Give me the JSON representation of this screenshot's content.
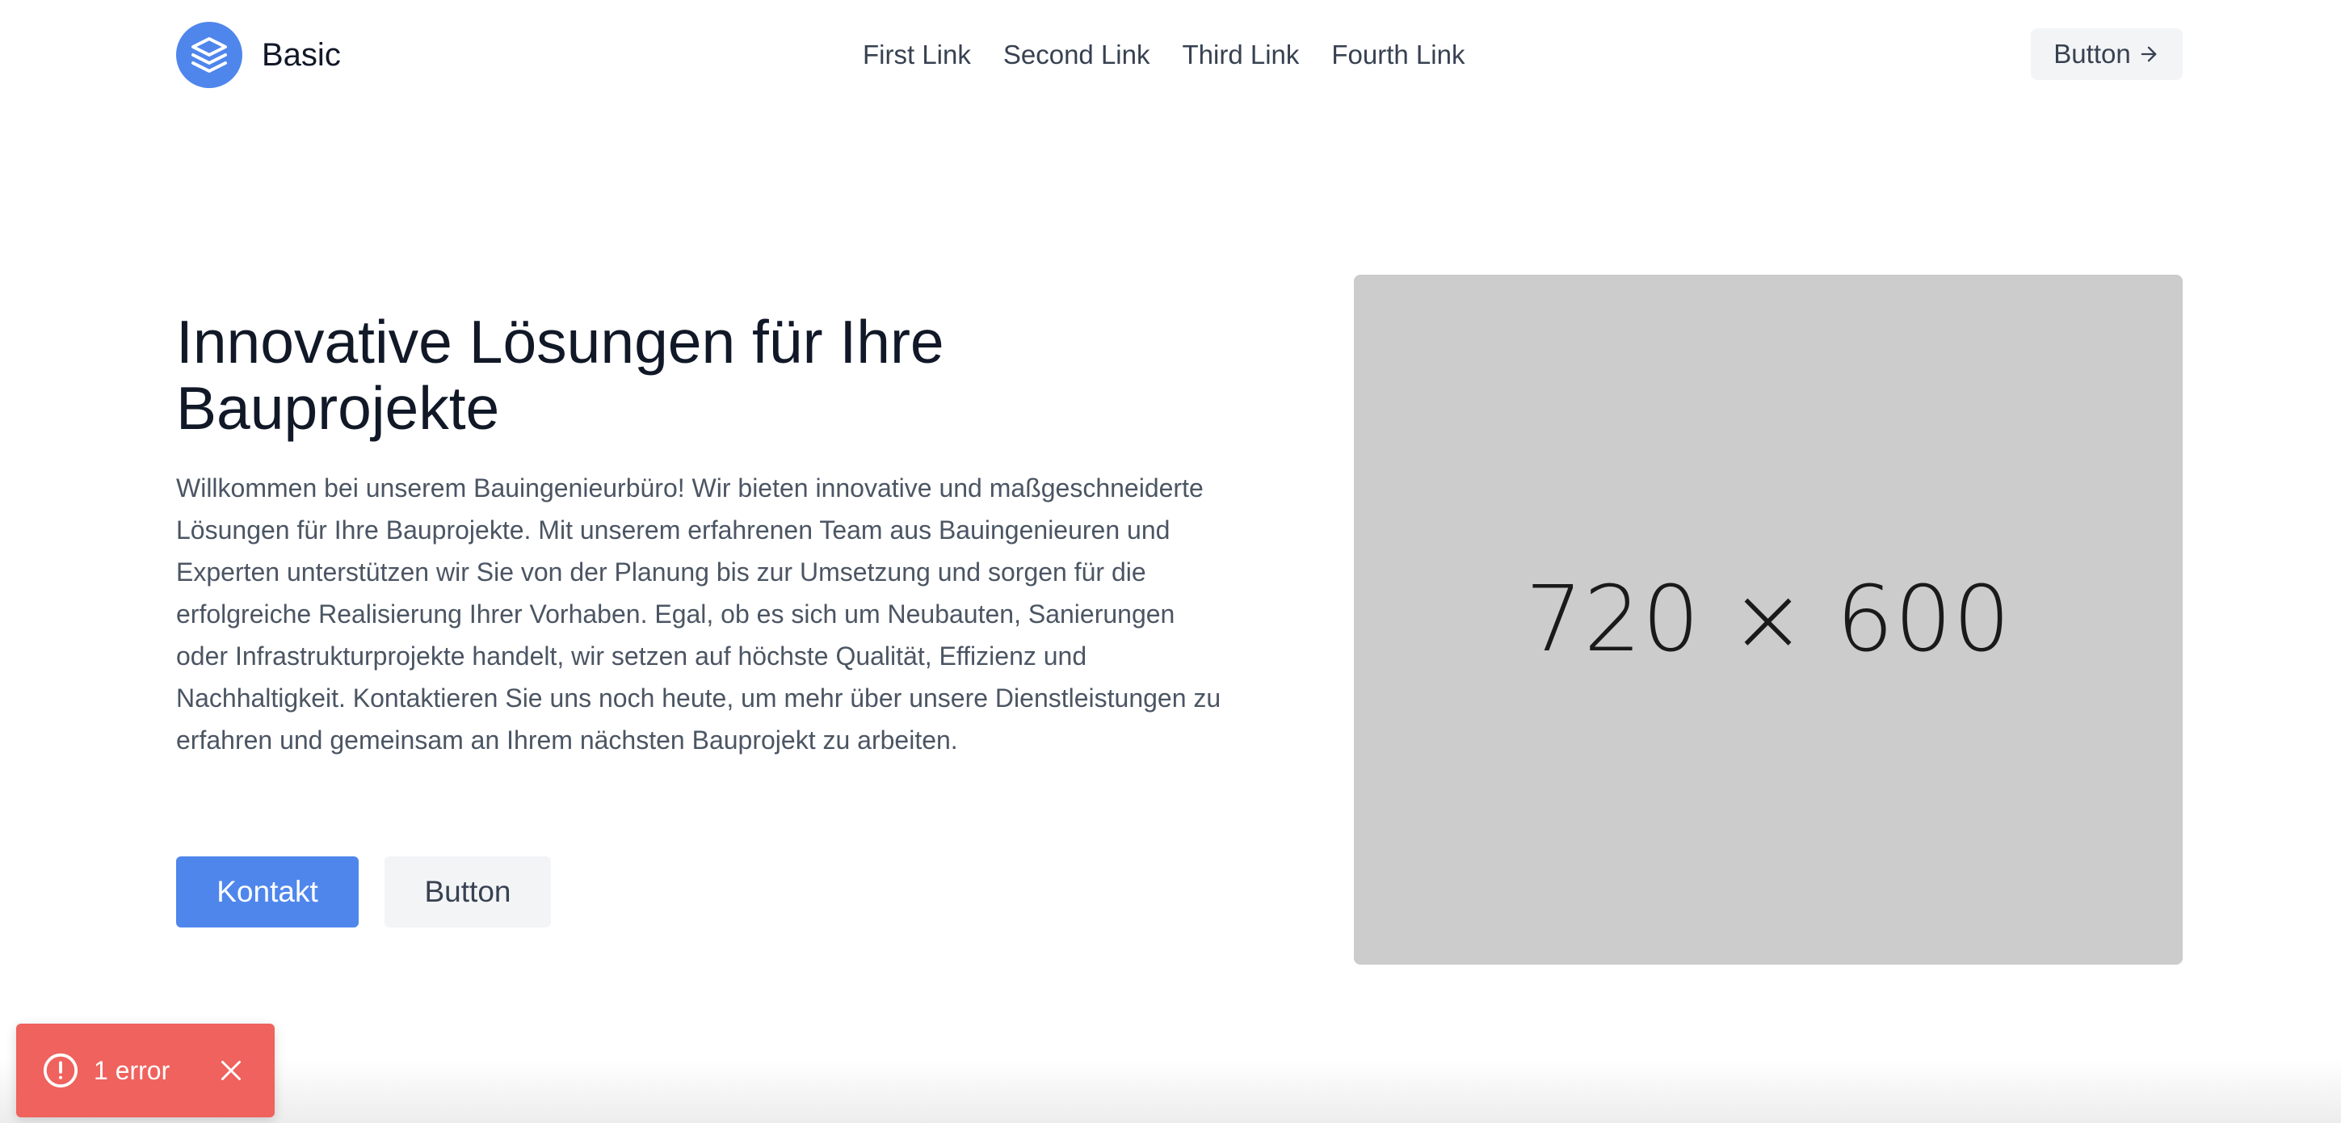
{
  "header": {
    "brand_name": "Basic",
    "brand_icon": "layers-icon",
    "nav": [
      {
        "label": "First Link"
      },
      {
        "label": "Second Link"
      },
      {
        "label": "Third Link"
      },
      {
        "label": "Fourth Link"
      }
    ],
    "button_label": "Button",
    "button_icon": "arrow-right-icon"
  },
  "hero": {
    "title": "Innovative Lösungen für Ihre Bauprojekte",
    "text": "Willkommen bei unserem Bauingenieurbüro! Wir bieten innovative und maßgeschneiderte Lösungen für Ihre Bauprojekte. Mit unserem erfahrenen Team aus Bauingenieuren und Experten unterstützen wir Sie von der Planung bis zur Umsetzung und sorgen für die erfolgreiche Realisierung Ihrer Vorhaben. Egal, ob es sich um Neubauten, Sanierungen oder Infrastrukturprojekte handelt, wir setzen auf höchste Qualität, Effizienz und Nachhaltigkeit. Kontaktieren Sie uns noch heute, um mehr über unsere Dienstleistungen zu erfahren und gemeinsam an Ihrem nächsten Bauprojekt zu arbeiten.",
    "primary_button": "Kontakt",
    "secondary_button": "Button",
    "image_label": "720 × 600"
  },
  "toast": {
    "text": "1 error",
    "icon": "alert-circle-icon",
    "close_icon": "close-icon"
  },
  "colors": {
    "accent": "#4f86ec",
    "placeholder": "#cccccc",
    "error": "#ef625d",
    "button_bg": "#f3f4f6"
  }
}
